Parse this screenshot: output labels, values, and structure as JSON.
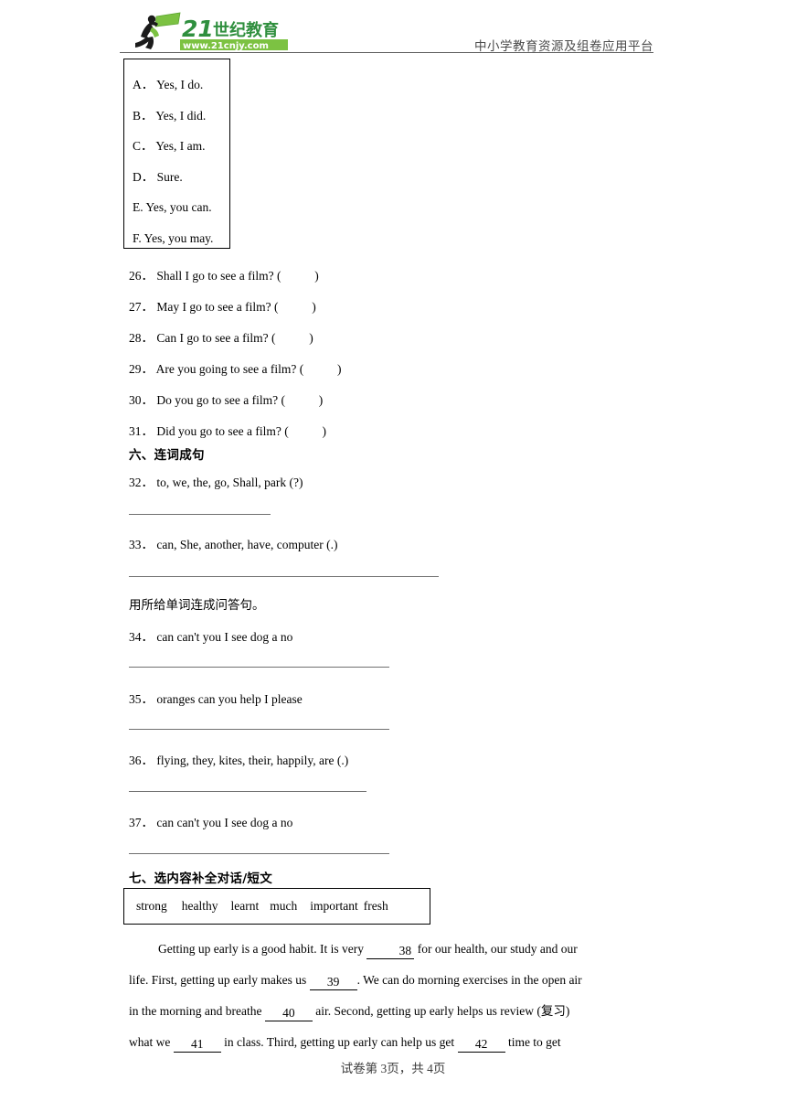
{
  "header": {
    "logo_text": "21世纪教育",
    "logo_url": "www.21cnjy.com",
    "tagline": "中小学教育资源及组卷应用平台"
  },
  "option_box": {
    "options": [
      "A．  Yes, I do.",
      "B．  Yes, I did.",
      "C．    Yes, I am.",
      "D．  Sure.",
      "E. Yes, you can.",
      "F. Yes, you may."
    ]
  },
  "match_questions": [
    {
      "num": "26．",
      "text": "Shall I go to see a film? (",
      "close": ")"
    },
    {
      "num": "27．",
      "text": "May I go to see a film? (",
      "close": ")"
    },
    {
      "num": "28．",
      "text": "Can I go to see a film? (",
      "close": ")"
    },
    {
      "num": "29．",
      "text": "Are you going to see a film? (",
      "close": ")"
    },
    {
      "num": "30．",
      "text": "Do you go to see a film? (",
      "close": ")"
    },
    {
      "num": "31．",
      "text": "Did you go to see a film? (",
      "close": ")"
    }
  ],
  "section_six": {
    "heading": "六、连词成句",
    "items": [
      {
        "num": "32．",
        "text": "to, we, the, go, Shall, park (?)"
      },
      {
        "num": "33．",
        "text": "can, She, another, have, computer (.)"
      }
    ],
    "instruction": "用所给单词连成问答句。",
    "items2": [
      {
        "num": "34．",
        "text": "can can't you I see dog a no"
      },
      {
        "num": "35．",
        "text": "oranges can you help I please"
      },
      {
        "num": "36．",
        "text": "flying, they, kites, their, happily, are (.)"
      },
      {
        "num": "37．",
        "text": "can can't you I see dog a no"
      }
    ]
  },
  "section_seven": {
    "heading": "七、选内容补全对话/短文",
    "word_bank": [
      "strong",
      "healthy",
      "learnt",
      "much",
      "important",
      "fresh"
    ],
    "passage": {
      "l1a": "Getting up early is a good habit. It is very ",
      "b38": "38",
      "l1b": " for our health, our study and our",
      "l2a": "life. First, getting up early makes us ",
      "b39": "39",
      "l2b": ". We can do morning exercises in the open air",
      "l3a": "in the morning and breathe ",
      "b40": "40",
      "l3b": " air. Second, getting up early helps us review (复习)",
      "l4a": "what we ",
      "b41": "41",
      "l4b": " in class. Third, getting up early can help us get ",
      "b42": "42",
      "l4c": " time to get"
    }
  },
  "footer": {
    "text": "试卷第 3页，共 4页"
  }
}
